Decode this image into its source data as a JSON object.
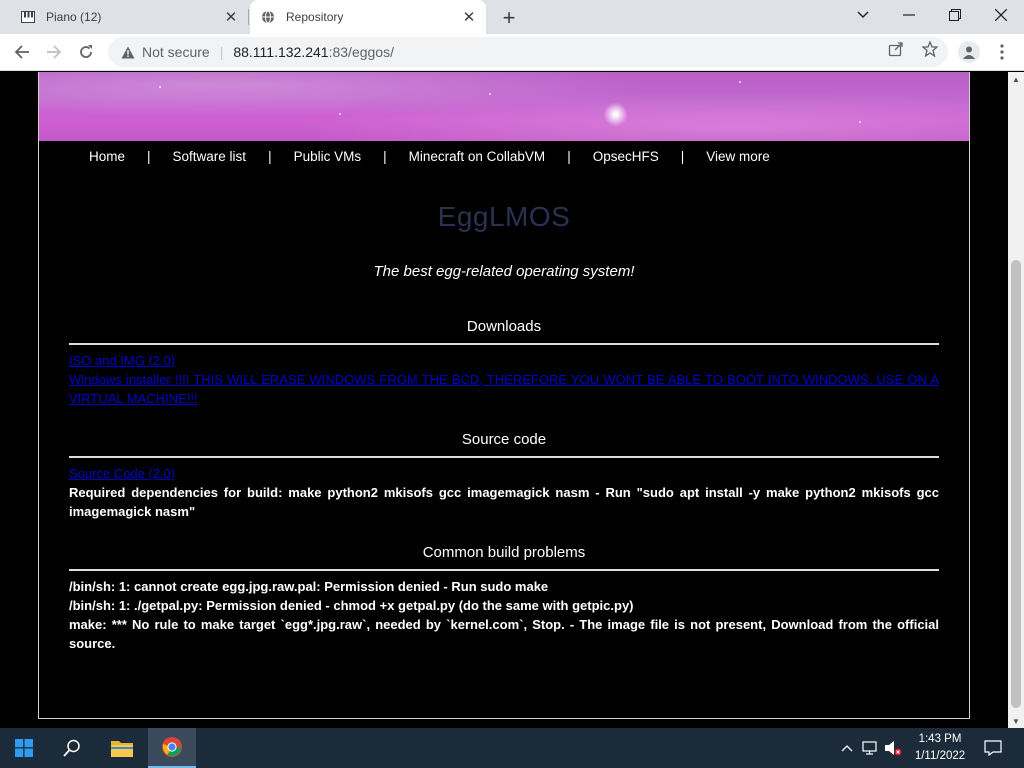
{
  "browser": {
    "tabs": [
      {
        "title": "Piano (12)",
        "icon": "piano-icon",
        "active": false
      },
      {
        "title": "Repository",
        "icon": "globe-icon",
        "active": true
      }
    ],
    "security_label": "Not secure",
    "url_host": "88.111.132.241",
    "url_rest": ":83/eggos/"
  },
  "site": {
    "nav": [
      "Home",
      "Software list",
      "Public VMs",
      "Minecraft on CollabVM",
      "OpsecHFS",
      "View more"
    ],
    "nav_separator": "|",
    "title": "EggLMOS",
    "tagline": "The best egg-related operating system!",
    "sections": {
      "downloads": {
        "heading": "Downloads",
        "links": [
          "ISO and IMG (2.0)",
          "Windows installer !!!! THIS WILL ERASE WINDOWS FROM THE BCD, THEREFORE YOU WONT BE ABLE TO BOOT INTO WINDOWS. USE ON A VIRTUAL MACHINE!!!"
        ]
      },
      "source": {
        "heading": "Source code",
        "link": "Source Code (2.0)",
        "text": "Required dependencies for build: make python2 mkisofs gcc imagemagick nasm - Run \"sudo apt install -y make python2 mkisofs gcc imagemagick nasm\""
      },
      "problems": {
        "heading": "Common build problems",
        "lines": [
          "/bin/sh: 1: cannot create egg.jpg.raw.pal: Permission denied - Run sudo make",
          "/bin/sh: 1: ./getpal.py: Permission denied - chmod +x getpal.py (do the same with getpic.py)",
          "make: *** No rule to make target `egg*.jpg.raw`, needed by `kernel.com`, Stop. - The image file is not present, Download from the official source."
        ]
      }
    }
  },
  "taskbar": {
    "time": "1:43 PM",
    "date": "1/11/2022"
  },
  "colors": {
    "title_color": "#2b3150",
    "link_color": "#0000cc",
    "banner_magenta": "#c167cf",
    "taskbar_bg": "#1c2b3a"
  }
}
